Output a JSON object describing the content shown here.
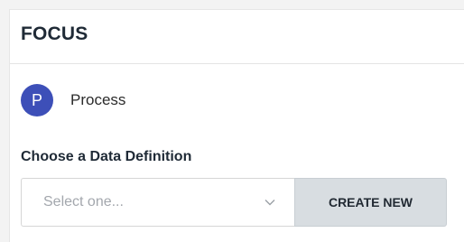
{
  "panel": {
    "title": "FOCUS"
  },
  "entity": {
    "avatar_letter": "P",
    "avatar_color": "#3d4fb8",
    "name": "Process"
  },
  "data_definition": {
    "label": "Choose a Data Definition",
    "select_placeholder": "Select one...",
    "chevron_icon": "chevron-down-icon",
    "create_button_label": "CREATE NEW"
  }
}
